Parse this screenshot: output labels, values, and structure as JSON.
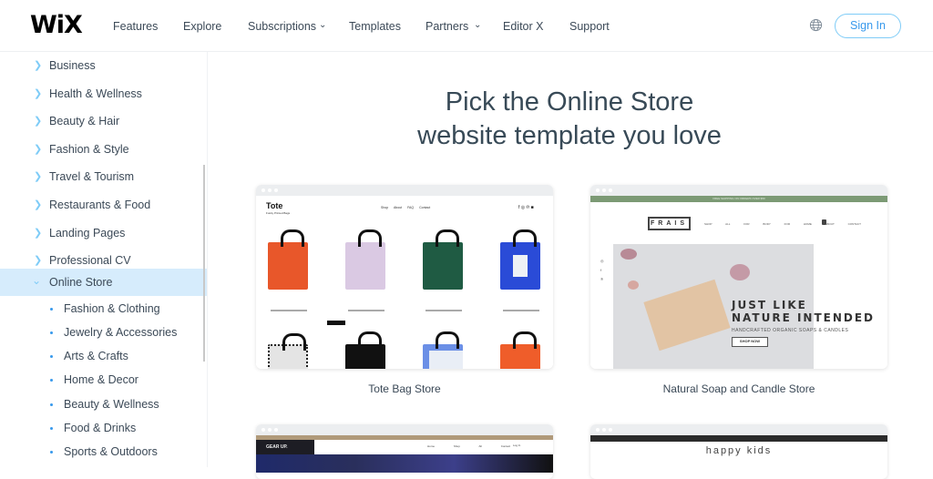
{
  "header": {
    "logo": "WiX",
    "nav": [
      "Features",
      "Explore",
      "Subscriptions",
      "Templates",
      "Partners",
      "Editor X",
      "Support"
    ],
    "sign_in": "Sign In",
    "brand_color": "#3899ec"
  },
  "sidebar": {
    "categories": [
      "Business",
      "Health & Wellness",
      "Beauty & Hair",
      "Fashion & Style",
      "Travel & Tourism",
      "Restaurants & Food",
      "Landing Pages",
      "Professional CV"
    ],
    "active": "Online Store",
    "subcategories": [
      "Fashion & Clothing",
      "Jewelry & Accessories",
      "Arts & Crafts",
      "Home & Decor",
      "Beauty & Wellness",
      "Food & Drinks",
      "Sports & Outdoors"
    ]
  },
  "main": {
    "title_line1": "Pick the Online Store",
    "title_line2": "website template you love",
    "templates": [
      {
        "name": "Tote Bag Store",
        "brand": "Tote",
        "tagline": "Funky Printed Bags",
        "menu": [
          "Shop",
          "About",
          "FAQ",
          "Contact"
        ]
      },
      {
        "name": "Natural Soap and Candle Store",
        "brand": "FRAIS",
        "banner": "FREE SHIPPING ON ORDERS OVER $50",
        "menu": [
          "SHOP ALL",
          "FOR BODY",
          "FOR HOME",
          "ABOUT",
          "CONTACT"
        ],
        "headline1": "JUST LIKE",
        "headline2": "NATURE INTENDED",
        "subhead": "HANDCRAFTED ORGANIC SOAPS & CANDLES",
        "cta": "SHOP NOW"
      },
      {
        "name": "Gear Up",
        "brand": "GEAR UP.",
        "menu": [
          "Home",
          "Shop All",
          "Contact"
        ],
        "login": "Log In"
      },
      {
        "name": "Happy Kids",
        "brand": "happy kids"
      }
    ]
  }
}
